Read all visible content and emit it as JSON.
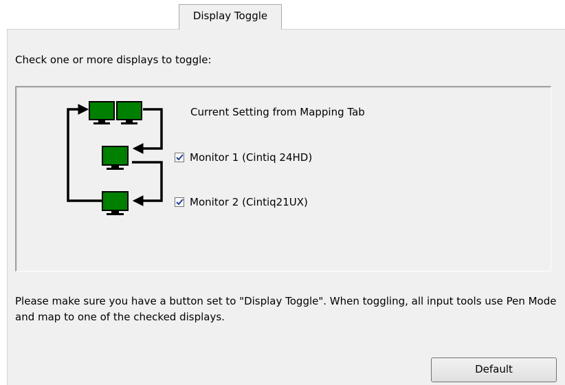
{
  "tab": {
    "label": "Display Toggle"
  },
  "instruction": "Check one or more displays to toggle:",
  "diagram": {
    "current_setting_label": "Current Setting from Mapping Tab",
    "monitor_color": "#008000",
    "monitors": [
      {
        "label": "Monitor 1 (Cintiq 24HD)",
        "checked": true
      },
      {
        "label": "Monitor 2 (Cintiq21UX)",
        "checked": true
      }
    ]
  },
  "note": "Please make sure you have a button set to \"Display Toggle\". When toggling, all input tools use Pen Mode and map to one of the checked displays.",
  "buttons": {
    "default_label": "Default"
  }
}
